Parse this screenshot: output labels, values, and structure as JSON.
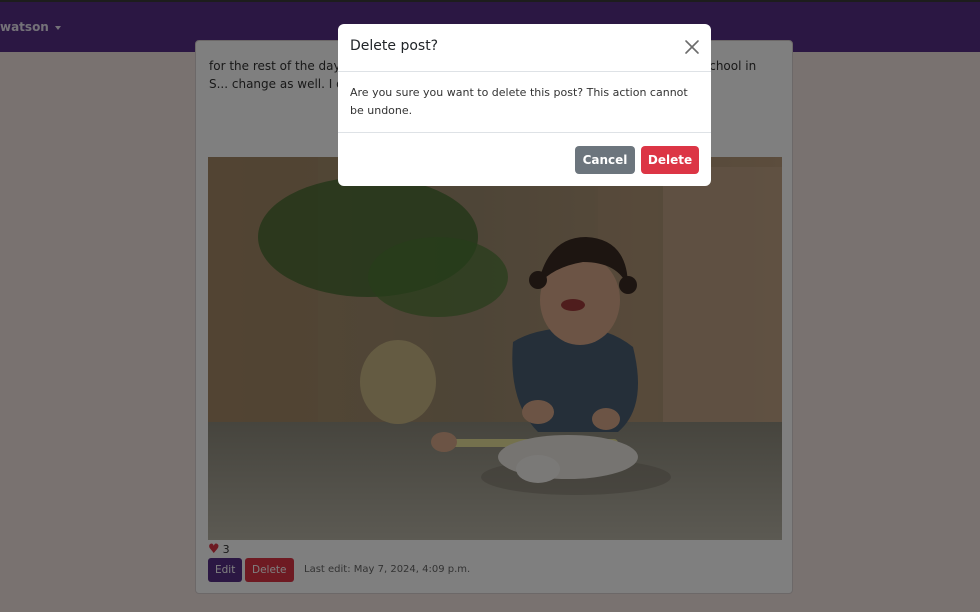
{
  "navbar": {
    "username": "watson"
  },
  "post": {
    "text": "for the rest of the day, ... join in in the activities as much ... she's 4 so she'll go to school in S... change as well. I don't even know ... ing similar happening and found a...",
    "likes": "3",
    "edit_label": "Edit",
    "delete_label": "Delete",
    "last_edit": "Last edit: May 7, 2024, 4:09 p.m."
  },
  "modal": {
    "title": "Delete post?",
    "body": "Are you sure you want to delete this post? This action cannot be undone.",
    "cancel_label": "Cancel",
    "confirm_label": "Delete"
  },
  "colors": {
    "brand": "#562f87",
    "danger": "#dc3545",
    "secondary": "#6c757d"
  },
  "icons": {
    "close": "close-icon",
    "like": "heart-icon",
    "user_menu": "caret-down-icon"
  }
}
